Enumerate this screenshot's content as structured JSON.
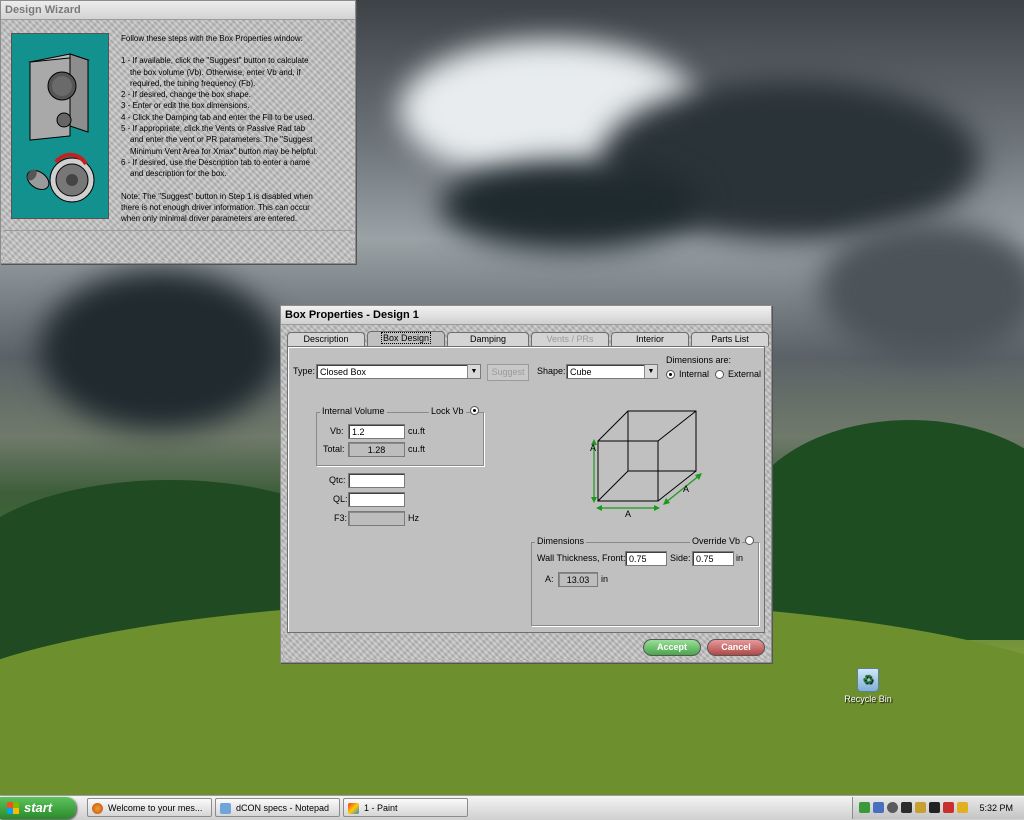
{
  "desktop": {
    "recycle_bin_label": "Recycle Bin"
  },
  "design_wizard": {
    "title": "Design Wizard",
    "intro": "Follow these steps with the Box Properties window:",
    "steps": [
      [
        "1 - If available, click the \"Suggest\" button to calculate",
        "the box volume (Vb). Otherwise, enter Vb and, if",
        "required, the tuning frequency (Fb)."
      ],
      [
        "2 - If desired, change the box shape."
      ],
      [
        "3 - Enter or edit the box dimensions."
      ],
      [
        "4 - Click the Damping tab and enter the Fill to be used."
      ],
      [
        "5 - If appropriate, click the Vents or Passive Rad tab",
        "and enter the vent or PR parameters. The \"Suggest",
        "Minimum Vent Area for Xmax\" button may be helpful."
      ],
      [
        "6 - If desired, use the Description tab to enter a name",
        "and description for the box."
      ]
    ],
    "note": [
      "Note: The \"Suggest\" button in Step 1 is disabled when",
      "there is not enough driver information. This can occur",
      "when only minimal driver parameters are entered."
    ]
  },
  "box_properties": {
    "title": "Box Properties - Design 1",
    "tabs": [
      "Description",
      "Box Design",
      "Damping",
      "Vents / PRs",
      "Interior",
      "Parts List"
    ],
    "active_tab": "Box Design",
    "type_label": "Type:",
    "type_value": "Closed Box",
    "suggest_label": "Suggest",
    "shape_label": "Shape:",
    "shape_value": "Cube",
    "dimensions_are_label": "Dimensions are:",
    "internal_label": "Internal",
    "external_label": "External",
    "internal_selected": true,
    "internal_volume_label": "Internal Volume",
    "lock_vb_label": "Lock Vb",
    "vb_label": "Vb:",
    "vb_value": "1.2",
    "vb_unit": "cu.ft",
    "total_label": "Total:",
    "total_value": "1.28",
    "total_unit": "cu.ft",
    "qtc_label": "Qtc:",
    "ql_label": "QL:",
    "f3_label": "F3:",
    "f3_unit": "Hz",
    "cube_dim_label": "A",
    "dimensions_group_label": "Dimensions",
    "override_vb_label": "Override Vb",
    "wall_thickness_label": "Wall Thickness, Front:",
    "wall_front_value": "0.75",
    "side_label": "Side:",
    "wall_side_value": "0.75",
    "wall_unit": "in",
    "a_label": "A:",
    "a_value": "13.03",
    "a_unit": "in",
    "accept_label": "Accept",
    "cancel_label": "Cancel"
  },
  "taskbar": {
    "start_label": "start",
    "tasks": [
      "Welcome to your mes...",
      "dCON specs - Notepad",
      "1 - Paint"
    ],
    "clock": "5:32 PM"
  },
  "colors": {
    "wizard_art_bg": "#13918f",
    "accept": "#4aa44a",
    "cancel": "#b04848",
    "cube_lines": "#000000",
    "dimension_arrows": "#1a9a1a"
  }
}
